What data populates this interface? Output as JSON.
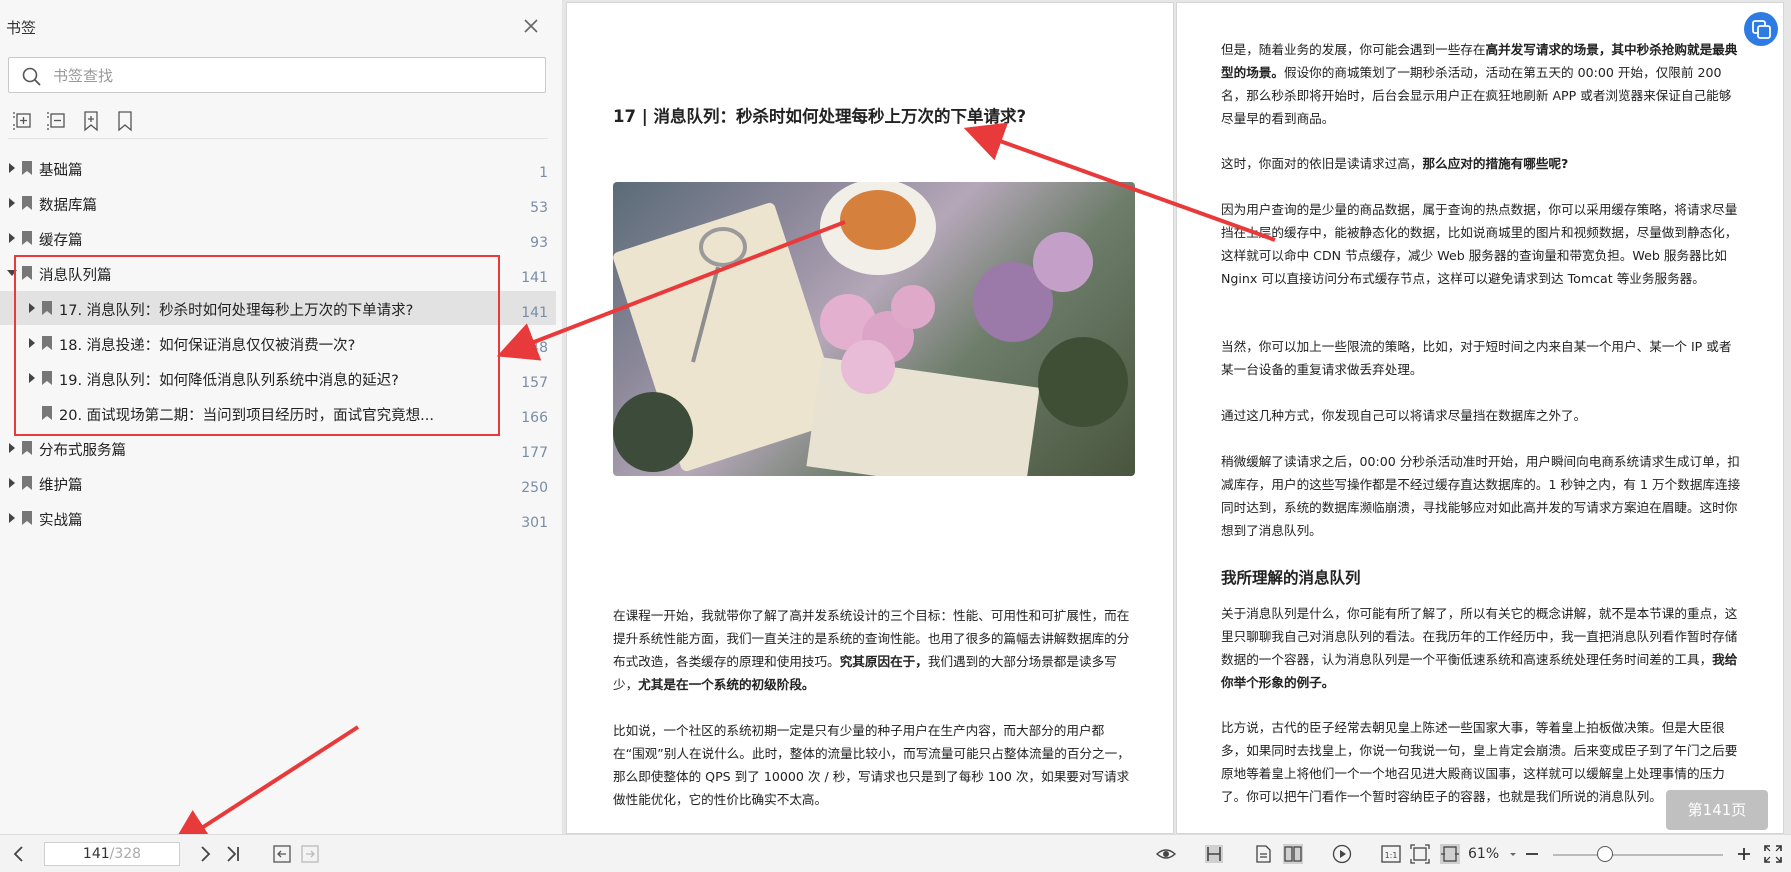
{
  "sidebar": {
    "title": "书签",
    "search_placeholder": "书签查找",
    "bookmarks": [
      {
        "label": "基础篇",
        "page": "1"
      },
      {
        "label": "数据库篇",
        "page": "53"
      },
      {
        "label": "缓存篇",
        "page": "93"
      },
      {
        "label": "消息队列篇",
        "page": "141"
      },
      {
        "label": "17. 消息队列：秒杀时如何处理每秒上万次的下单请求?",
        "page": "141"
      },
      {
        "label": "18. 消息投递：如何保证消息仅仅被消费一次?",
        "page": "148"
      },
      {
        "label": "19. 消息队列：如何降低消息队列系统中消息的延迟?",
        "page": "157"
      },
      {
        "label": "20. 面试现场第二期：当问到项目经历时，面试官究竟想...",
        "page": "166"
      },
      {
        "label": "分布式服务篇",
        "page": "177"
      },
      {
        "label": "维护篇",
        "page": "250"
      },
      {
        "label": "实战篇",
        "page": "301"
      }
    ]
  },
  "document": {
    "title": "17 | 消息队列：秒杀时如何处理每秒上万次的下单请求?",
    "left_p1": {
      "a": "在课程一开始，我就带你了解了高并发系统设计的三个目标：性能、可用性和可扩展性，而在提升系统性能方面，我们一直关注的是系统的查询性能。也用了很多的篇幅去讲解数据库的分布式改造，各类缓存的原理和使用技巧。",
      "b": "究其原因在于，",
      "c": "我们遇到的大部分场景都是读多写少，",
      "d": "尤其是在一个系统的初级阶段。"
    },
    "left_p2": "比如说，一个社区的系统初期一定是只有少量的种子用户在生产内容，而大部分的用户都在“围观”别人在说什么。此时，整体的流量比较小，而写流量可能只占整体流量的百分之一，那么即使整体的 QPS 到了 10000 次 / 秒，写请求也只是到了每秒 100 次，如果要对写请求做性能优化，它的性价比确实不太高。",
    "r1": {
      "a": "但是，随着业务的发展，你可能会遇到一些存在",
      "b": "高并发写请求的场景，其中秒杀抢购就是最典型的场景。",
      "c": "假设你的商城策划了一期秒杀活动，活动在第五天的 00:00 开始，仅限前 200 名，那么秒杀即将开始时，后台会显示用户正在疯狂地刷新 APP 或者浏览器来保证自己能够尽量早的看到商品。"
    },
    "r2": {
      "a": "这时，你面对的依旧是读请求过高，",
      "b": "那么应对的措施有哪些呢?"
    },
    "r3": "因为用户查询的是少量的商品数据，属于查询的热点数据，你可以采用缓存策略，将请求尽量挡在上层的缓存中，能被静态化的数据，比如说商城里的图片和视频数据，尽量做到静态化，这样就可以命中 CDN 节点缓存，减少 Web 服务器的查询量和带宽负担。Web 服务器比如 Nginx 可以直接访问分布式缓存节点，这样可以避免请求到达 Tomcat 等业务服务器。",
    "r4": "当然，你可以加上一些限流的策略，比如，对于短时间之内来自某一个用户、某一个 IP 或者某一台设备的重复请求做丢弃处理。",
    "r5": "通过这几种方式，你发现自己可以将请求尽量挡在数据库之外了。",
    "r6": "稍微缓解了读请求之后，00:00 分秒杀活动准时开始，用户瞬间向电商系统请求生成订单，扣减库存，用户的这些写操作都是不经过缓存直达数据库的。1 秒钟之内，有 1 万个数据库连接同时达到，系统的数据库濒临崩溃，寻找能够应对如此高并发的写请求方案迫在眉睫。这时你想到了消息队列。",
    "r_heading": "我所理解的消息队列",
    "r7": {
      "a": "关于消息队列是什么，你可能有所了解了，所以有关它的概念讲解，就不是本节课的重点，这里只聊聊我自己对消息队列的看法。在我历年的工作经历中，我一直把消息队列看作暂时存储数据的一个容器，认为消息队列是一个平衡低速系统和高速系统处理任务时间差的工具，",
      "b": "我给你举个形象的例子。"
    },
    "r8": "比方说，古代的臣子经常去朝见皇上陈述一些国家大事，等着皇上拍板做决策。但是大臣很多，如果同时去找皇上，你说一句我说一句，皇上肯定会崩溃。后来变成臣子到了午门之后要原地等着皇上将他们一个一个地召见进大殿商议国事，这样就可以缓解皇上处理事情的压力了。你可以把午门看作一个暂时容纳臣子的容器，也就是我们所说的消息队列。",
    "page_badge": "第141页"
  },
  "bottom_bar": {
    "current_page": "141",
    "total_pages": "/328",
    "zoom": "61%"
  }
}
